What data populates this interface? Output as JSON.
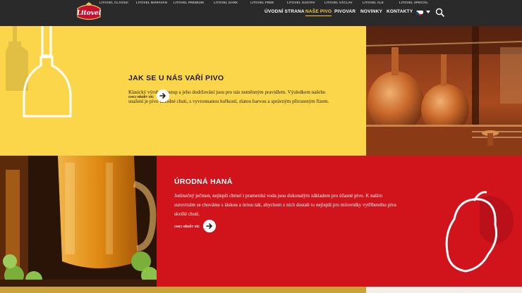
{
  "header": {
    "top_links": [
      "LITOVEL CLASSIC",
      "LITOVEL MORAVAN",
      "LITOVEL PREMIUM",
      "LITOVEL DARK",
      "LITOVEL FREE",
      "LITOVEL GUSTAV",
      "LITOVEL VÁCLAV",
      "LITOVEL ALE",
      "LITOVEL SPECIÁL"
    ],
    "logo_text": "Litovel",
    "nav": [
      "ÚVODNÍ STRANA",
      "NAŠE PIVO",
      "PIVOVAR",
      "NOVINKY",
      "KONTAKTY"
    ],
    "active_nav": "NAŠE PIVO"
  },
  "section_brewing": {
    "title": "JAK SE U NÁS VAŘÍ PIVO",
    "text": "Klasický výrobní postup a jeho dodržování jsou pro nás neměnným pravidlem. Výsledkem našeho snažení je pivo lahodné chuti, s vyvronnanou hořkostí, zlatou barvou a správným přirozeným řízem.",
    "cta": "CHCI VĚDĚT VÍC"
  },
  "section_hana": {
    "title": "ÚRODNÁ HANÁ",
    "text": "Jedinečný ječmen, nejlepší chmel i pramenitá voda jsou dokonalým základem pro úžasné pivo. K našim surovinám se chováme s láskou a úctou tak, abychom z nich dostali to nejlepší pro milovníky vytříbeného piva skvělé chuti.",
    "cta": "CHCI VĚDĚT VÍC"
  },
  "colors": {
    "yellow": "#fbd64a",
    "red": "#d1131c",
    "header": "#2a2a2a",
    "accent": "#f5c842"
  }
}
